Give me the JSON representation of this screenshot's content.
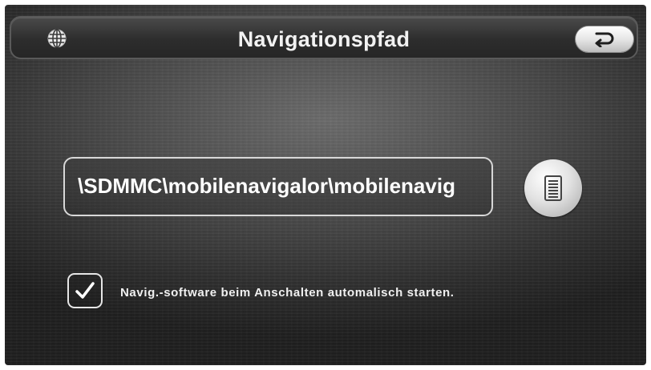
{
  "header": {
    "title": "Navigationspfad",
    "left_icon": "globe-icon",
    "back_icon": "return-arrow-icon"
  },
  "path": {
    "value": "\\SDMMC\\mobilenavigalor\\mobilenavig"
  },
  "browse": {
    "icon": "list-icon"
  },
  "autostart": {
    "checked": true,
    "label": "Navig.-software beim Anschalten automalisch starten."
  },
  "colors": {
    "text": "#ffffff",
    "button_face": "#e6e6e6",
    "background": "#3a3a3a"
  }
}
